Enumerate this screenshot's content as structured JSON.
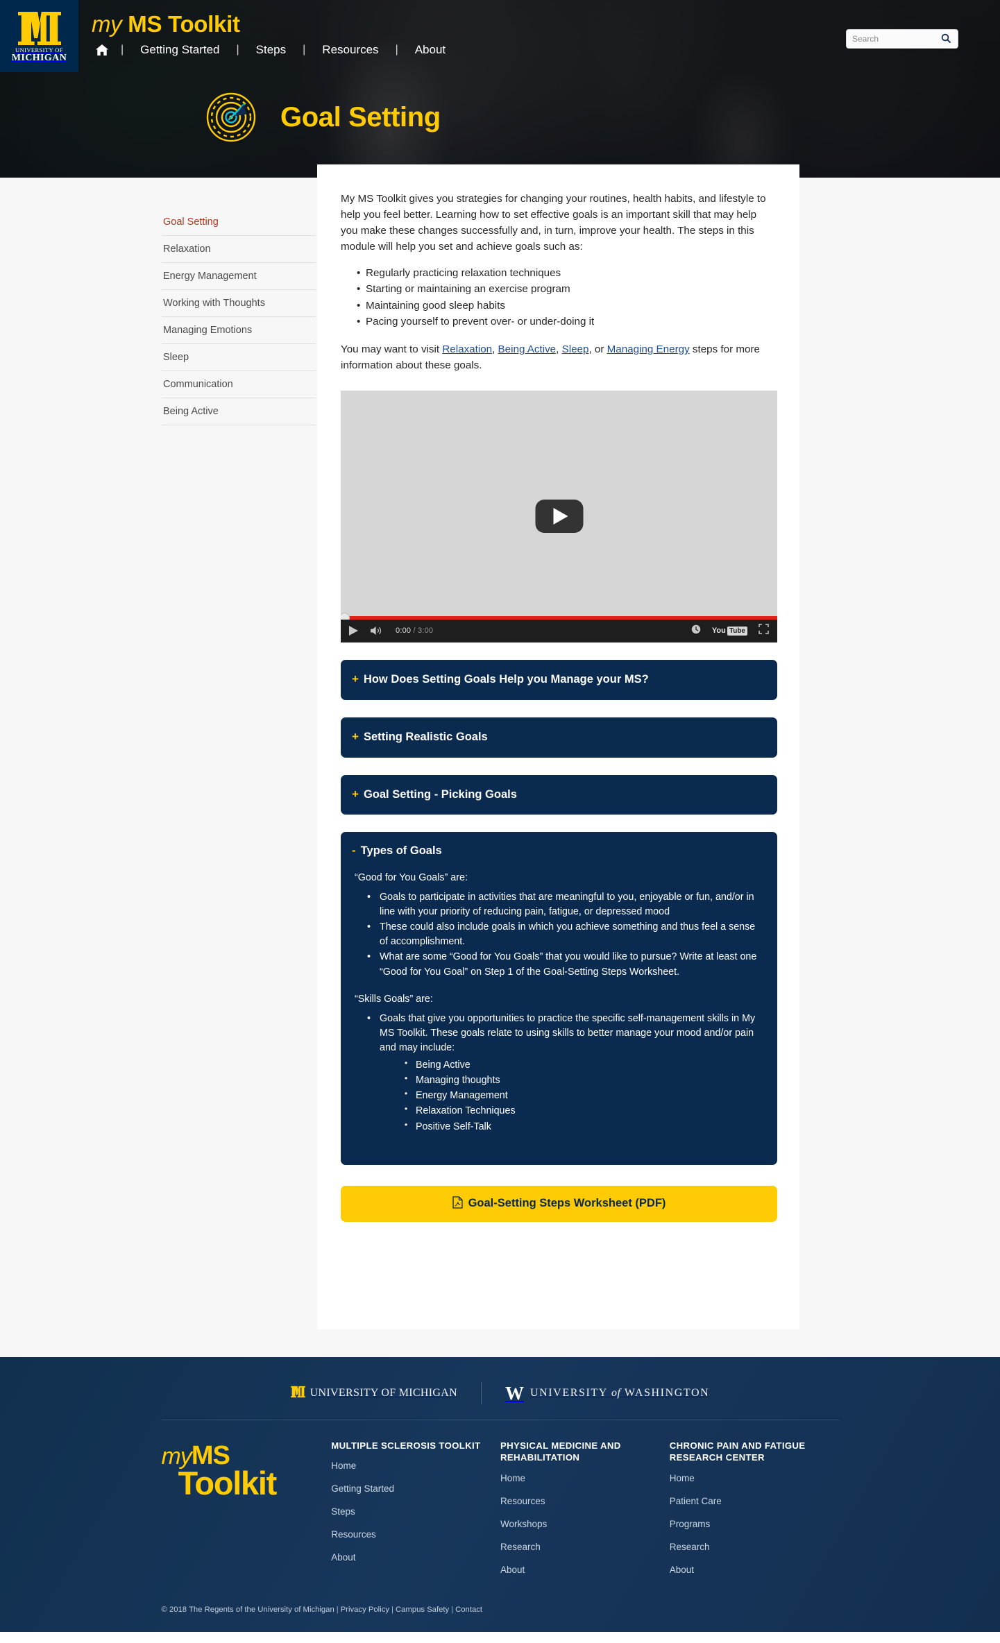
{
  "header": {
    "university_line1": "UNIVERSITY OF",
    "university_line2": "MICHIGAN",
    "brand_my": "my",
    "brand_rest": "MS Toolkit",
    "nav": [
      {
        "label": "Getting Started"
      },
      {
        "label": "Steps"
      },
      {
        "label": "Resources"
      },
      {
        "label": "About"
      }
    ],
    "nav_separator": "|",
    "home_icon": "home-icon",
    "search": {
      "placeholder": "Search",
      "value": "",
      "icon": "search-icon"
    }
  },
  "hero": {
    "module_icon": "target-goal-icon",
    "module_title": "Goal Setting"
  },
  "sidebar": {
    "items": [
      {
        "label": "Goal Setting",
        "active": true
      },
      {
        "label": "Relaxation",
        "active": false
      },
      {
        "label": "Energy Management",
        "active": false
      },
      {
        "label": "Working with Thoughts",
        "active": false
      },
      {
        "label": "Managing Emotions",
        "active": false
      },
      {
        "label": "Sleep",
        "active": false
      },
      {
        "label": "Communication",
        "active": false
      },
      {
        "label": "Being Active",
        "active": false
      }
    ]
  },
  "main": {
    "intro_paragraph": "My MS Toolkit gives you strategies for changing your routines, health habits, and lifestyle to help you feel better. Learning how to set effective goals is an important skill that may help you make these changes successfully and, in turn, improve your health.  The steps in this module will help you set and achieve goals such as:",
    "intro_bullets": [
      "Regularly practicing relaxation techniques",
      "Starting or maintaining an exercise program",
      "Maintaining good sleep habits",
      "Pacing yourself to prevent over- or under-doing it"
    ],
    "visit_prefix": "You may want to visit ",
    "visit_links": [
      {
        "label": "Relaxation",
        "after": ", "
      },
      {
        "label": "Being Active",
        "after": ", "
      },
      {
        "label": "Sleep",
        "after": ", or "
      },
      {
        "label": "Managing Energy",
        "after": ""
      }
    ],
    "visit_suffix": " steps for more information about these goals.",
    "video": {
      "play_icon": "play-button-icon",
      "current_time": "0:00",
      "time_separator": " / ",
      "duration": "3:00",
      "volume_icon": "volume-icon",
      "watch_later_icon": "clock-icon",
      "fullscreen_icon": "fullscreen-icon",
      "youtube_logo_you": "You",
      "youtube_logo_tube": "Tube",
      "progress_percent": 100
    },
    "accordions": [
      {
        "toggle": "+",
        "title": "How Does Setting Goals Help you Manage your MS?",
        "open": false
      },
      {
        "toggle": "+",
        "title": "Setting Realistic Goals",
        "open": false
      },
      {
        "toggle": "+",
        "title": "Goal Setting - Picking Goals",
        "open": false
      }
    ],
    "open_accordion": {
      "toggle": "-",
      "title": "Types of Goals",
      "good_heading": "“Good for You Goals” are:",
      "good_bullets": [
        "Goals to participate in activities that are meaningful to you, enjoyable or fun, and/or in line with your priority of reducing pain, fatigue, or depressed mood",
        "These could also include goals in which you achieve something and thus feel a sense of accomplishment.",
        "What are some “Good for You Goals” that you would like to pursue? Write at least one “Good for You Goal” on Step 1 of the Goal-Setting Steps Worksheet."
      ],
      "skills_heading": "“Skills Goals” are:",
      "skills_bullet": "Goals that give you opportunities to practice the specific self-management skills in My MS Toolkit.  These goals relate to using skills to better manage your mood and/or pain and may include:",
      "skills_sub_bullets": [
        "Being Active",
        "Managing thoughts",
        "Energy Management",
        "Relaxation Techniques",
        "Positive Self-Talk"
      ]
    },
    "pdf_button": {
      "icon": "pdf-file-icon",
      "label": "Goal-Setting Steps Worksheet (PDF)"
    }
  },
  "footer": {
    "university_michigan": "UNIVERSITY OF MICHIGAN",
    "university_washington_w": "W",
    "university_washington_pre": "UNIVERSITY ",
    "university_washington_of": "of",
    "university_washington_post": " WASHINGTON",
    "brand_my": "my",
    "brand_ms": "MS",
    "brand_toolkit": "Toolkit",
    "columns": [
      {
        "heading": "MULTIPLE SCLEROSIS TOOLKIT",
        "links": [
          "Home",
          "Getting Started",
          "Steps",
          "Resources",
          "About"
        ]
      },
      {
        "heading": "PHYSICAL MEDICINE AND REHABILITATION",
        "links": [
          "Home",
          "Resources",
          "Workshops",
          "Research",
          "About"
        ]
      },
      {
        "heading": "CHRONIC PAIN AND FATIGUE RESEARCH CENTER",
        "links": [
          "Home",
          "Patient Care",
          "Programs",
          "Research",
          "About"
        ]
      }
    ],
    "copyright": "© 2018 The Regents of the University of Michigan",
    "legal_links": [
      "Privacy Policy",
      "Campus Safety",
      "Contact"
    ],
    "legal_separator": "|"
  },
  "colors": {
    "um_blue": "#00274c",
    "um_maize": "#ffcb05",
    "panel_navy": "#0b2a4f",
    "footer_navy": "#133254",
    "active_link": "#b5341f",
    "body_link": "#1d4f91",
    "youtube_red": "#e62117"
  }
}
